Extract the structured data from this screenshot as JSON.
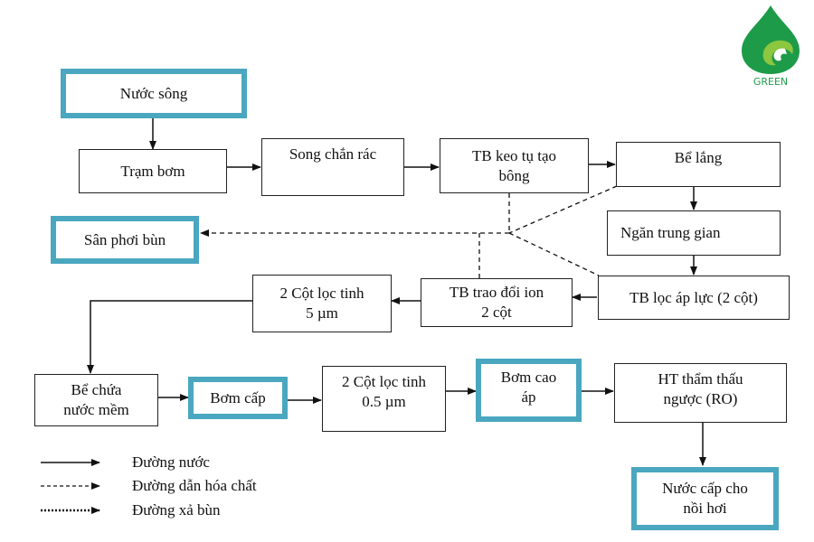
{
  "diagram": {
    "nodes": {
      "nuoc_song": "Nước sông",
      "tram_bom": "Trạm bơm",
      "song_chan_rac": "Song chắn rác",
      "tb_keo_tu": "TB keo tụ tạo bông",
      "be_lang": "Bể lắng",
      "san_phoi_bun": "Sân phơi bùn",
      "ngan_trung_gian": "Ngăn trung gian",
      "tb_loc_ap_luc": "TB lọc áp lực (2 cột)",
      "tb_trao_doi_ion_l1": "TB trao đổi ion",
      "tb_trao_doi_ion_l2": "2 cột",
      "cot_loc_5_l1": "2 Cột lọc tinh",
      "cot_loc_5_l2": "5 µm",
      "be_chua_l1": "Bể chứa",
      "be_chua_l2": "nước mềm",
      "bom_cap": "Bơm cấp",
      "cot_loc_05_l1": "2 Cột lọc tinh",
      "cot_loc_05_l2": "0.5 µm",
      "bom_cao_ap_l1": "Bơm cao",
      "bom_cao_ap_l2": "áp",
      "ro_l1": "HT thẩm thấu",
      "ro_l2": "ngược (RO)",
      "nuoc_cap_l1": "Nước cấp cho",
      "nuoc_cap_l2": "nồi hơi"
    },
    "keo_tu_l1": "TB keo tụ tạo",
    "keo_tu_l2": "bông"
  },
  "legend": [
    {
      "style": "solid",
      "label": "Đường nước"
    },
    {
      "style": "dashed",
      "label": "Đường dẫn hóa chất"
    },
    {
      "style": "dotted",
      "label": "Đường xả bùn"
    }
  ],
  "logo": {
    "text": "GREEN"
  },
  "colors": {
    "accent": "#4aa7bf",
    "logo_green": "#1e9b48",
    "logo_light": "#8dc63f"
  }
}
